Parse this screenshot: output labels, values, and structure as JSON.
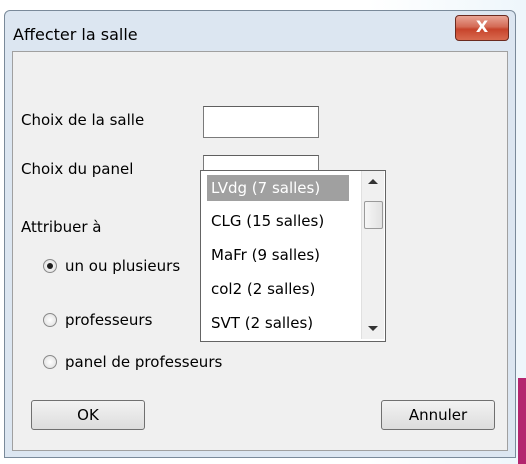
{
  "window": {
    "title": "Affecter la salle",
    "close_glyph": "X"
  },
  "form": {
    "salle_label": "Choix de la salle",
    "salle_value": "",
    "panel_label": "Choix du panel",
    "panel_value": "",
    "attribuer_label": "Attribuer à"
  },
  "radios": [
    {
      "label": "un ou plusieurs",
      "checked": true
    },
    {
      "label": "professeurs",
      "checked": false
    },
    {
      "label": "panel de professeurs",
      "checked": false
    }
  ],
  "dropdown": {
    "items": [
      {
        "label": "LVdg (7 salles)",
        "selected": true
      },
      {
        "label": "CLG (15 salles)",
        "selected": false
      },
      {
        "label": "MaFr (9 salles)",
        "selected": false
      },
      {
        "label": "col2 (2 salles)",
        "selected": false
      },
      {
        "label": "SVT (2 salles)",
        "selected": false
      }
    ]
  },
  "buttons": {
    "ok": "OK",
    "cancel": "Annuler"
  },
  "colors": {
    "close_button": "#c7442c",
    "accent_bar": "#b3266f",
    "selected_item": "#a0a0a0"
  },
  "icons": {
    "close": "close-icon",
    "scroll_up": "scroll-up-arrow-icon",
    "scroll_down": "scroll-down-arrow-icon"
  }
}
